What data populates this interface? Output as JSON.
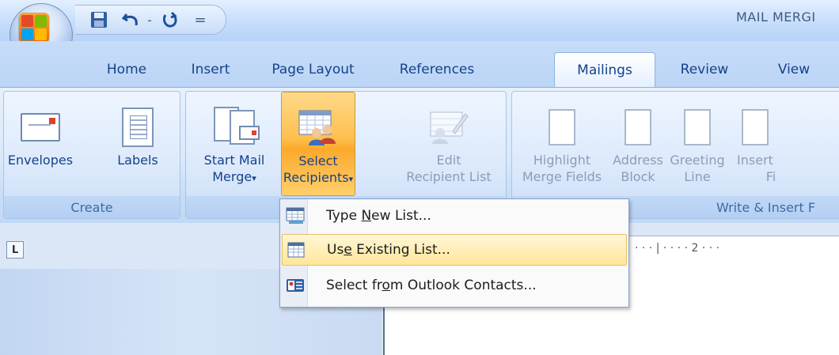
{
  "titlebar": {
    "document_title": "MAIL MERGI"
  },
  "quick_access": {
    "separator": "-",
    "more": "="
  },
  "tabs": [
    {
      "label": "Home"
    },
    {
      "label": "Insert"
    },
    {
      "label": "Page Layout"
    },
    {
      "label": "References"
    },
    {
      "label": "Mailings",
      "active": true
    },
    {
      "label": "Review"
    },
    {
      "label": "View"
    }
  ],
  "ribbon": {
    "groups": {
      "create": {
        "label": "Create"
      },
      "start": {
        "label": ""
      },
      "write_insert": {
        "label": "Write & Insert F"
      }
    },
    "buttons": {
      "envelopes": "Envelopes",
      "labels": "Labels",
      "start_mail_merge_1": "Start Mail",
      "start_mail_merge_2": "Merge",
      "select_recipients_1": "Select",
      "select_recipients_2": "Recipients",
      "edit_list_1": "Edit",
      "edit_list_2": "Recipient List",
      "highlight_1": "Highlight",
      "highlight_2": "Merge Fields",
      "address_1": "Address",
      "address_2": "Block",
      "greeting_1": "Greeting",
      "greeting_2": "Line",
      "insert_1": "Insert",
      "insert_2": "Fi"
    },
    "dropdown_arrow": "▾"
  },
  "ruler": {
    "ticks": "· · · | · · · · 2 · · ·"
  },
  "ruler_corner": "L",
  "menu": {
    "items": [
      {
        "pre": "Type ",
        "accel": "N",
        "post": "ew List...",
        "icon": "type-list-icon"
      },
      {
        "pre": "Us",
        "accel": "e",
        "post": " Existing List...",
        "icon": "existing-list-icon",
        "highlighted": true
      },
      {
        "pre": "Select fr",
        "accel": "o",
        "post": "m Outlook Contacts...",
        "icon": "outlook-contacts-icon"
      }
    ]
  },
  "colors": {
    "accent": "#15428b",
    "ribbon_bg": "#dce9fb",
    "hot_button": "#ffbf4d",
    "menu_highlight": "#ffe69a"
  }
}
